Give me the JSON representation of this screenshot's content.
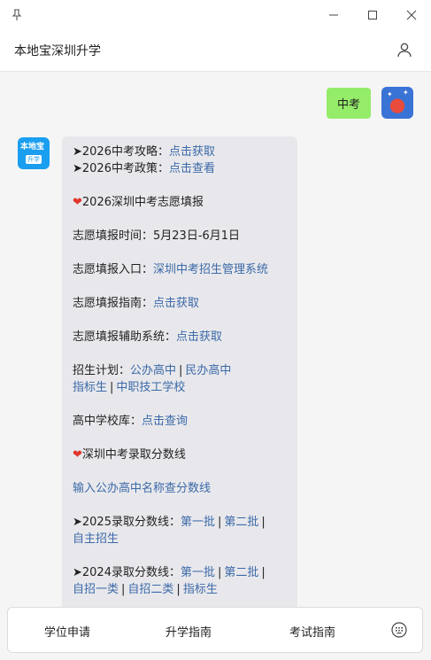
{
  "titlebar": {
    "pin_icon": "pin-icon",
    "minimize_icon": "minimize-icon",
    "maximize_icon": "maximize-icon",
    "close_icon": "close-icon"
  },
  "header": {
    "title": "本地宝深圳升学",
    "user_icon": "user-icon"
  },
  "chat": {
    "user_message": "中考",
    "bot_avatar_top": "本地宝",
    "bot_avatar_bottom": "升学",
    "bot": {
      "l1_prefix": "➤2026中考攻略：",
      "l1_link": "点击获取",
      "l2_prefix": "➤2026中考政策：",
      "l2_link": "点击查看",
      "heart": "❤",
      "sec1_title": "2026深圳中考志愿填报",
      "time_label": "志愿填报时间：5月23日-6月1日",
      "entry_label": "志愿填报入口：",
      "entry_link": "深圳中考招生管理系统",
      "guide_label": "志愿填报指南：",
      "guide_link": "点击获取",
      "aux_label": "志愿填报辅助系统：",
      "aux_link": "点击获取",
      "plan_label": "招生计划：",
      "plan_link1": "公办高中",
      "plan_link2": "民办高中",
      "plan_link3": "指标生",
      "plan_link4": "中职技工学校",
      "bar": "|",
      "school_label": "高中学校库：",
      "school_link": "点击查询",
      "sec2_title": "深圳中考录取分数线",
      "score_query_link": "输入公办高中名称查分数线",
      "s2025_prefix": "➤2025录取分数线：",
      "s2025_link1": "第一批",
      "s2025_link2": "第二批",
      "s2025_link3": "自主招生",
      "s2024_prefix": "➤2024录取分数线：",
      "s2024_link1": "第一批",
      "s2024_link2": "第二批",
      "s2024_link3": "自招一类",
      "s2024_link4": "自招二类",
      "s2024_link5": "指标生"
    }
  },
  "bottom_nav": {
    "item1": "学位申请",
    "item2": "升学指南",
    "item3": "考试指南",
    "keyboard_icon": "keyboard-icon"
  },
  "colors": {
    "user_bubble": "#95ec69",
    "bot_bubble": "#e8e8ec",
    "link": "#3b69a8",
    "heart": "#e0362c",
    "bot_avatar": "#1a9ef0"
  }
}
